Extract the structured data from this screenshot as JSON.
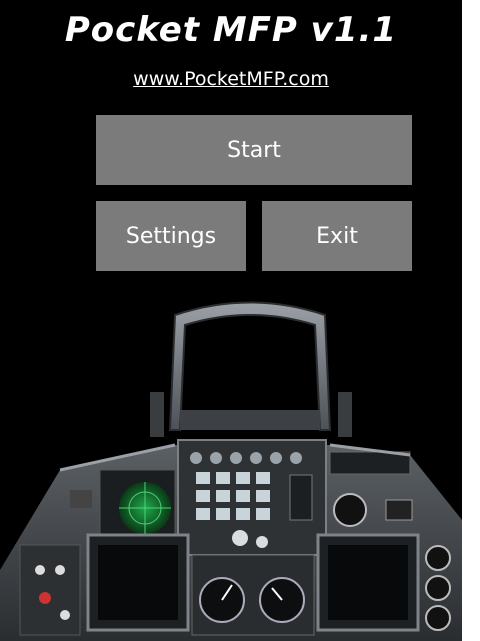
{
  "app": {
    "title": "Pocket MFP v1.1",
    "website": "www.PocketMFP.com"
  },
  "menu": {
    "start_label": "Start",
    "settings_label": "Settings",
    "exit_label": "Exit"
  },
  "cockpit_image": {
    "icon": "f16-cockpit-illustration",
    "radar_color": "#1fa84a",
    "panel_color": "#3a3d40"
  },
  "colors": {
    "background": "#000000",
    "button": "#7b7b7b",
    "text": "#ffffff"
  }
}
